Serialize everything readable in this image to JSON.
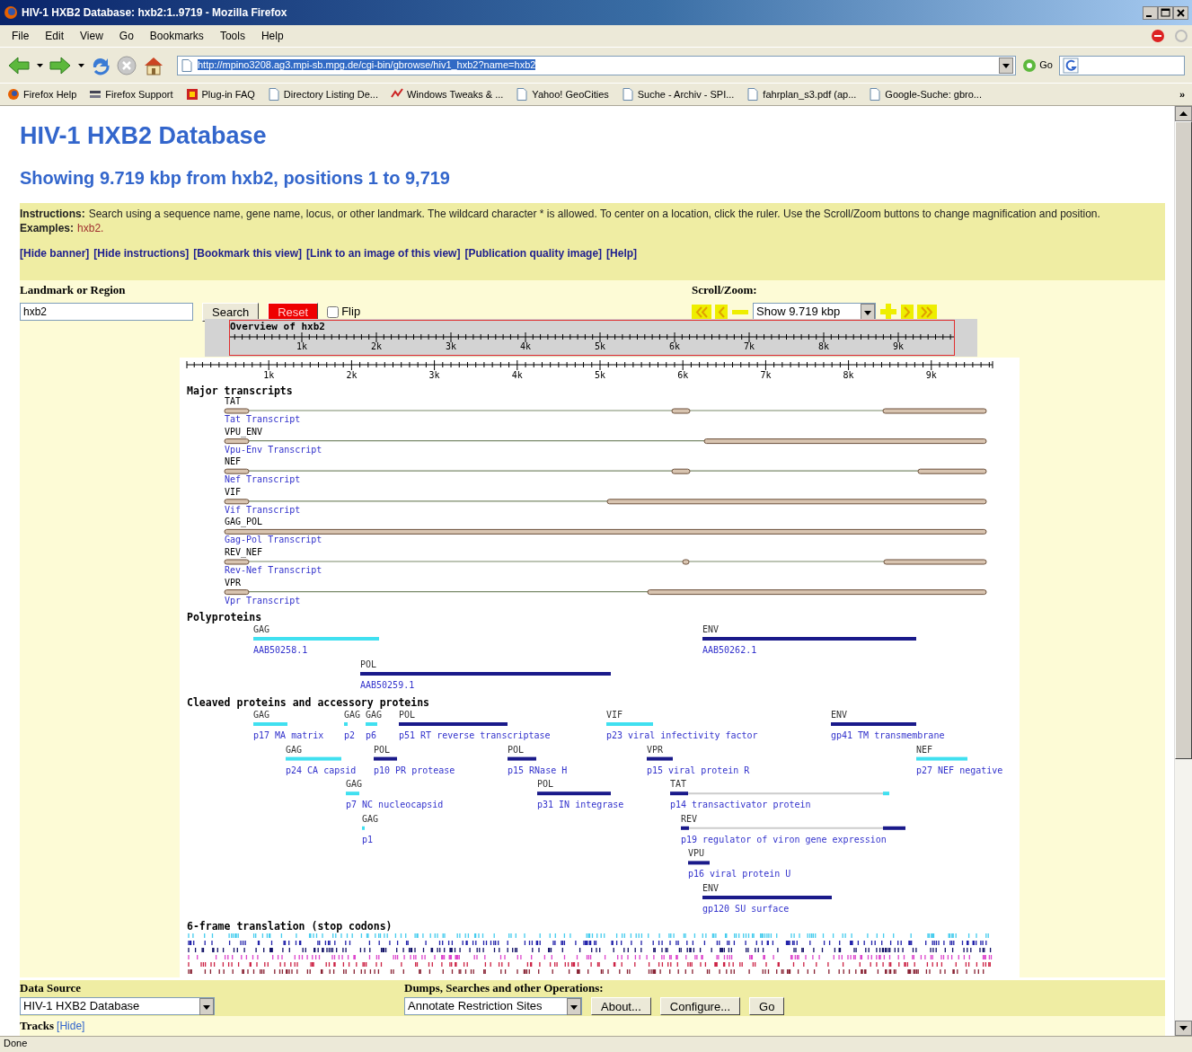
{
  "window": {
    "title": "HIV-1 HXB2 Database: hxb2:1..9719 - Mozilla Firefox"
  },
  "menu": [
    "File",
    "Edit",
    "View",
    "Go",
    "Bookmarks",
    "Tools",
    "Help"
  ],
  "toolbar": {
    "address": "http://mpino3208.ag3.mpi-sb.mpg.de/cgi-bin/gbrowse/hiv1_hxb2?name=hxb2",
    "address_selected": true,
    "go": "Go"
  },
  "bookmarks": [
    {
      "label": "Firefox Help",
      "kind": "firefox"
    },
    {
      "label": "Firefox Support",
      "kind": "support"
    },
    {
      "label": "Plug-in FAQ",
      "kind": "plugin"
    },
    {
      "label": "Directory Listing De...",
      "kind": "page"
    },
    {
      "label": "Windows Tweaks & ...",
      "kind": "tweak"
    },
    {
      "label": "Yahoo! GeoCities",
      "kind": "page"
    },
    {
      "label": "Suche - Archiv - SPI...",
      "kind": "page"
    },
    {
      "label": "fahrplan_s3.pdf (ap...",
      "kind": "page"
    },
    {
      "label": "Google-Suche: gbro...",
      "kind": "page"
    }
  ],
  "bookmarks_more": "»",
  "page": {
    "title": "HIV-1 HXB2 Database",
    "subtitle": "Showing 9.719 kbp from hxb2, positions 1 to 9,719",
    "instructions": {
      "label": "Instructions:",
      "text": "Search using a sequence name, gene name, locus, or other landmark. The wildcard character * is allowed. To center on a location, click the ruler. Use the Scroll/Zoom buttons to change magnification and position.",
      "examples_label": "Examples:",
      "example": "hxb2."
    },
    "links": [
      "[Hide banner]",
      "[Hide instructions]",
      "[Bookmark this view]",
      "[Link to an image of this view]",
      "[Publication quality image]",
      "[Help]"
    ],
    "landmark": {
      "label": "Landmark or Region",
      "value": "hxb2",
      "search": "Search",
      "reset": "Reset",
      "flip": {
        "label": "Flip",
        "checked": false
      }
    },
    "scroll_zoom": {
      "label": "Scroll/Zoom:",
      "zoom": "Show 9.719 kbp"
    },
    "overview": {
      "title": "Overview of hxb2",
      "ticks": [
        "1k",
        "2k",
        "3k",
        "4k",
        "5k",
        "6k",
        "7k",
        "8k",
        "9k"
      ]
    },
    "ruler": {
      "ticks": [
        "1k",
        "2k",
        "3k",
        "4k",
        "5k",
        "6k",
        "7k",
        "8k",
        "9k"
      ]
    },
    "tracks": {
      "transcripts_title": "Major transcripts",
      "transcripts": [
        {
          "gene": "TAT",
          "label": "Tat Transcript"
        },
        {
          "gene": "VPU_ENV",
          "label": "Vpu-Env Transcript"
        },
        {
          "gene": "NEF",
          "label": "Nef Transcript"
        },
        {
          "gene": "VIF",
          "label": "Vif Transcript"
        },
        {
          "gene": "GAG_POL",
          "label": "Gag-Pol Transcript"
        },
        {
          "gene": "REV_NEF",
          "label": "Rev-Nef Transcript"
        },
        {
          "gene": "VPR",
          "label": "Vpr Transcript"
        }
      ],
      "polyproteins_title": "Polyproteins",
      "polyproteins": [
        {
          "gene": "GAG",
          "label": "AAB50258.1",
          "color": "#40e0f0"
        },
        {
          "gene": "ENV",
          "label": "AAB50262.1",
          "color": "#1a1a8a"
        },
        {
          "gene": "POL",
          "label": "AAB50259.1",
          "color": "#1a1a8a"
        }
      ],
      "cleaved_title": "Cleaved proteins and accessory proteins",
      "cleaved": [
        {
          "gene": "GAG",
          "label": "p17 MA matrix",
          "color": "#40e0f0"
        },
        {
          "gene": "GAG",
          "label": "p2",
          "color": "#40e0f0"
        },
        {
          "gene": "GAG",
          "label": "p6",
          "color": "#40e0f0"
        },
        {
          "gene": "POL",
          "label": "p51 RT reverse transcriptase",
          "color": "#1a1a8a"
        },
        {
          "gene": "VIF",
          "label": "p23 viral infectivity factor",
          "color": "#40e0f0"
        },
        {
          "gene": "ENV",
          "label": "gp41 TM transmembrane",
          "color": "#1a1a8a"
        },
        {
          "gene": "GAG",
          "label": "p24 CA capsid",
          "color": "#40e0f0"
        },
        {
          "gene": "POL",
          "label": "p10 PR protease",
          "color": "#1a1a8a"
        },
        {
          "gene": "POL",
          "label": "p15 RNase H",
          "color": "#1a1a8a"
        },
        {
          "gene": "VPR",
          "label": "p15 viral protein R",
          "color": "#1a1a8a"
        },
        {
          "gene": "NEF",
          "label": "p27 NEF negative",
          "color": "#40e0f0"
        },
        {
          "gene": "GAG",
          "label": "p7 NC nucleocapsid",
          "color": "#40e0f0"
        },
        {
          "gene": "POL",
          "label": "p31 IN integrase",
          "color": "#1a1a8a"
        },
        {
          "gene": "TAT",
          "label": "p14 transactivator protein",
          "color": "#1a1a8a"
        },
        {
          "gene": "GAG",
          "label": "p1",
          "color": "#40e0f0"
        },
        {
          "gene": "REV",
          "label": "p19 regulator of viron gene expression",
          "color": "#1a1a8a"
        },
        {
          "gene": "VPU",
          "label": "p16 viral protein U",
          "color": "#1a1a8a"
        },
        {
          "gene": "ENV",
          "label": "gp120 SU surface",
          "color": "#1a1a8a"
        }
      ],
      "translation_title": "6-frame translation (stop codons)"
    },
    "footer": {
      "data_source_label": "Data Source",
      "data_source": "HIV-1 HXB2 Database",
      "operations_label": "Dumps, Searches and other Operations:",
      "operation": "Annotate Restriction Sites",
      "buttons": [
        "About...",
        "Configure...",
        "Go"
      ],
      "tracks_label": "Tracks",
      "tracks_link": "[Hide]"
    }
  },
  "status_bar": "Done"
}
